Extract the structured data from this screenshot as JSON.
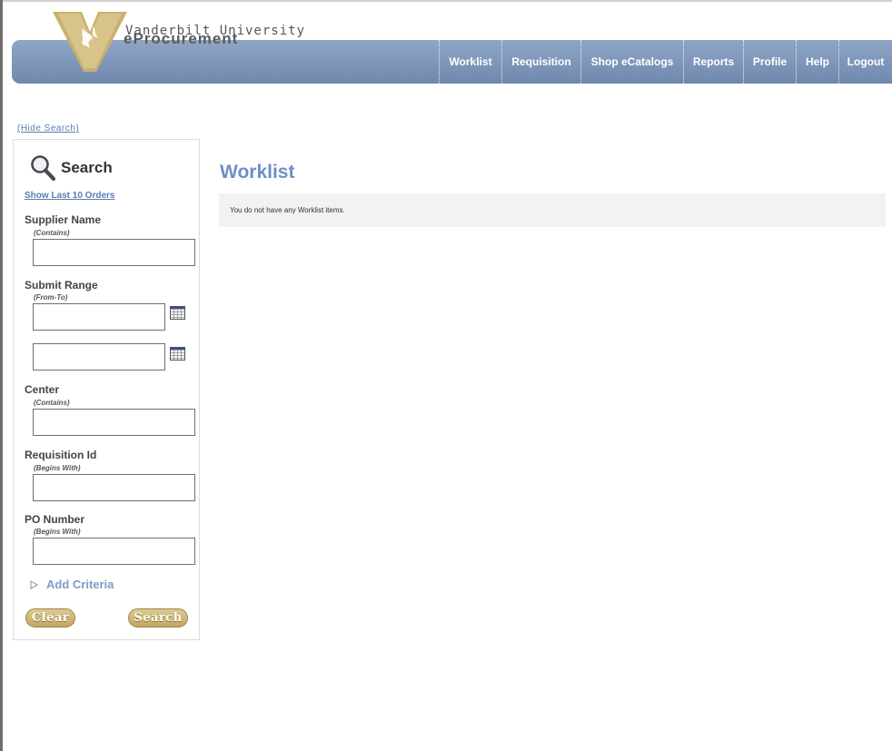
{
  "brand": {
    "name": "Vanderbilt University",
    "subtitle": "eProcurement",
    "colors": {
      "nav": "#7b93b8",
      "gold": "#c9b16e",
      "link": "#5a7bb0",
      "title": "#6e8fc2"
    }
  },
  "nav": {
    "items": [
      "Worklist",
      "Requisition",
      "Shop eCatalogs",
      "Reports",
      "Profile",
      "Help",
      "Logout"
    ]
  },
  "search_panel": {
    "hide_link": "(Hide Search)",
    "title": "Search",
    "icon": "magnifier-icon",
    "last_orders_link": "Show Last 10 Orders",
    "fields": [
      {
        "label": "Supplier Name",
        "hint": "(Contains)",
        "value": ""
      },
      {
        "label": "Submit Range",
        "hint": "(From-To)",
        "from_value": "",
        "to_value": ""
      },
      {
        "label": "Center",
        "hint": "(Contains)",
        "value": ""
      },
      {
        "label": "Requisition Id",
        "hint": "(Begins With)",
        "value": ""
      },
      {
        "label": "PO Number",
        "hint": "(Begins With)",
        "value": ""
      }
    ],
    "add_criteria": "Add Criteria",
    "clear_button": "Clear",
    "search_button": "Search"
  },
  "main": {
    "title": "Worklist",
    "message": "You do not have any Worklist items."
  }
}
